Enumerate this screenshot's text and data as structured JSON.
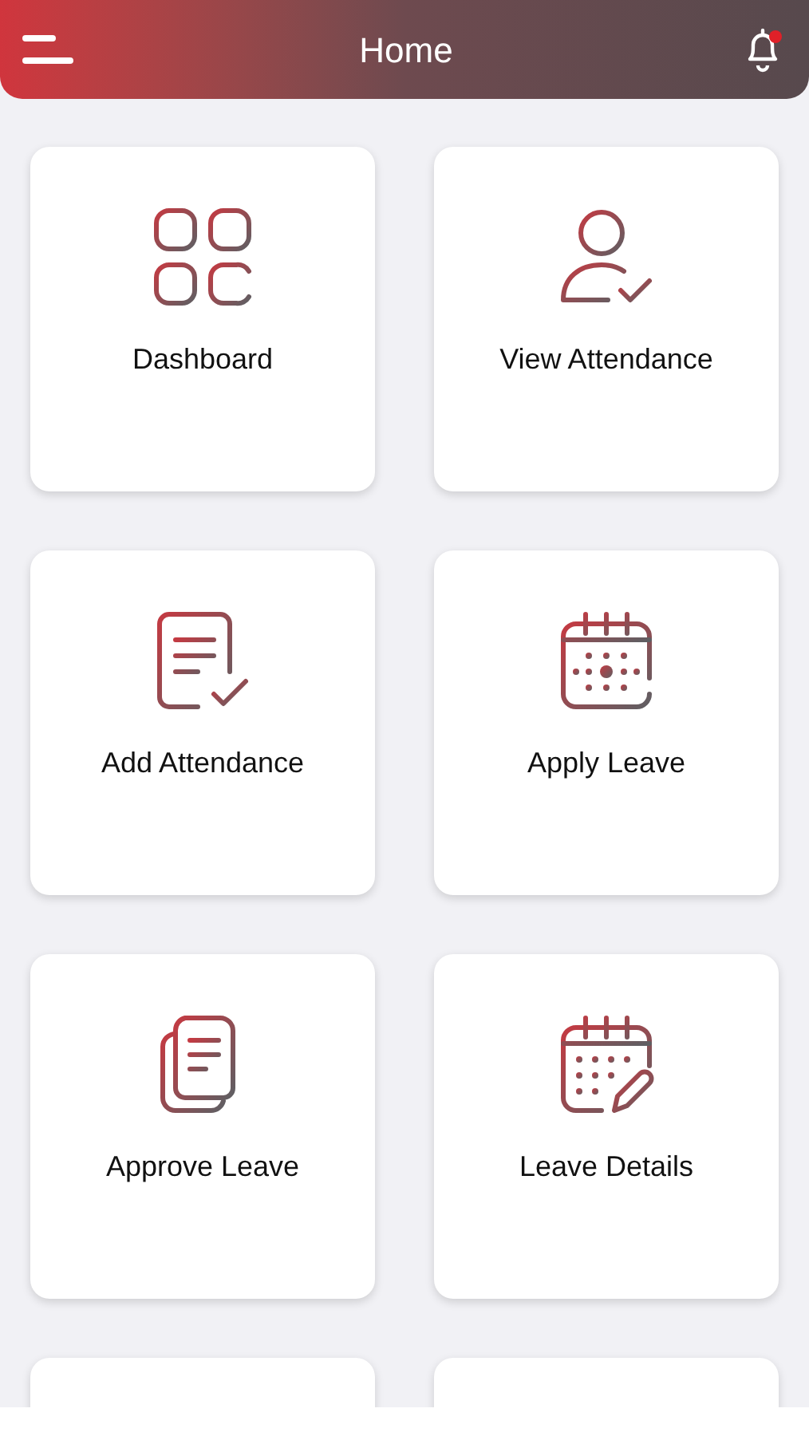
{
  "header": {
    "title": "Home",
    "notification_dot": true
  },
  "tiles": [
    {
      "kind": "grid",
      "label": "Dashboard"
    },
    {
      "kind": "user-check",
      "label": "View Attendance"
    },
    {
      "kind": "doc-check",
      "label": "Add Attendance"
    },
    {
      "kind": "calendar",
      "label": "Apply Leave"
    },
    {
      "kind": "docs",
      "label": "Approve Leave"
    },
    {
      "kind": "calendar-edit",
      "label": "Leave Details"
    },
    {
      "kind": "blank"
    },
    {
      "kind": "blank"
    }
  ]
}
